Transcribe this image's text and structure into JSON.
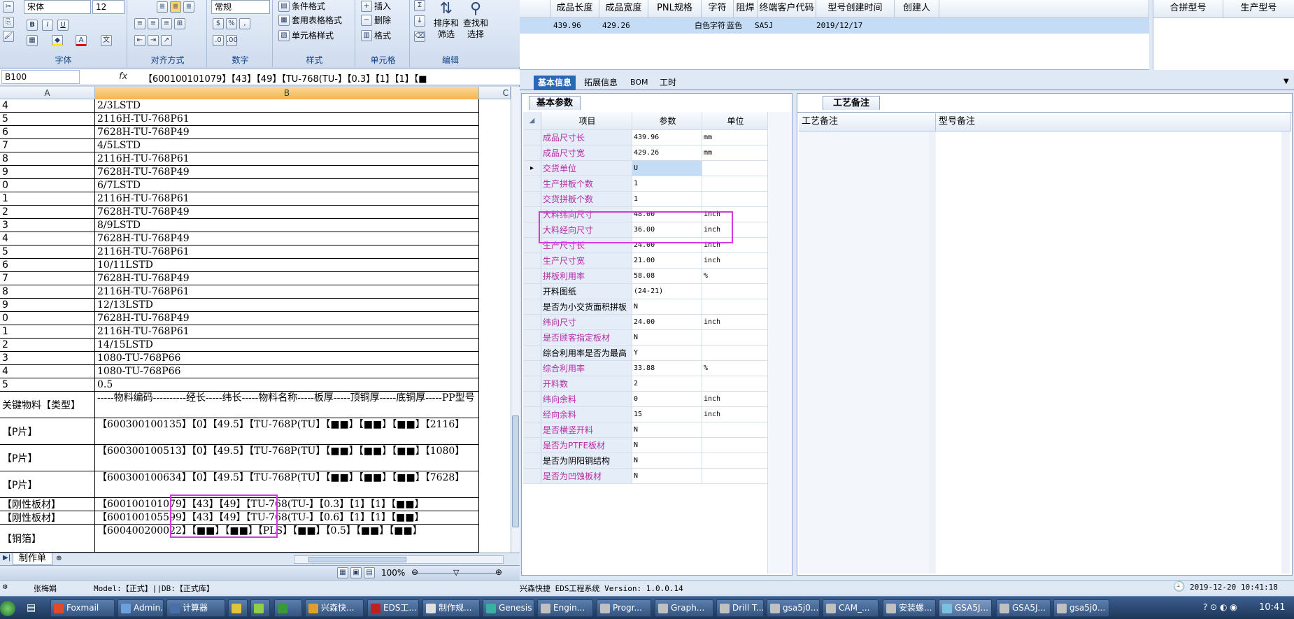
{
  "excel": {
    "font_name": "宋体",
    "font_size": "12",
    "number_format": "常规",
    "groups": [
      "字体",
      "对齐方式",
      "数字",
      "样式",
      "单元格",
      "编辑"
    ],
    "style_buttons": [
      "条件格式",
      "套用表格格式",
      "单元格样式"
    ],
    "cell_buttons": [
      "插入",
      "删除",
      "格式"
    ],
    "edit_buttons": [
      "排序和筛选",
      "查找和选择"
    ],
    "edit_sort_lines": [
      "排序和",
      "筛选"
    ],
    "edit_find_lines": [
      "查找和",
      "选择"
    ],
    "name_box": "B100",
    "formula": "【600100101079】【43】【49】【TU-768(TU-】【0.3】【1】【1】【■",
    "columns": [
      "A",
      "B",
      "C"
    ],
    "rows": [
      {
        "a": "4",
        "b": "2/3LSTD"
      },
      {
        "a": "5",
        "b": "2116H-TU-768P61"
      },
      {
        "a": "6",
        "b": "7628H-TU-768P49"
      },
      {
        "a": "7",
        "b": "4/5LSTD"
      },
      {
        "a": "8",
        "b": "2116H-TU-768P61"
      },
      {
        "a": "9",
        "b": "7628H-TU-768P49"
      },
      {
        "a": "0",
        "b": "6/7LSTD"
      },
      {
        "a": "1",
        "b": "2116H-TU-768P61"
      },
      {
        "a": "2",
        "b": "7628H-TU-768P49"
      },
      {
        "a": "3",
        "b": "8/9LSTD"
      },
      {
        "a": "4",
        "b": "7628H-TU-768P49"
      },
      {
        "a": "5",
        "b": "2116H-TU-768P61"
      },
      {
        "a": "6",
        "b": "10/11LSTD"
      },
      {
        "a": "7",
        "b": "7628H-TU-768P49"
      },
      {
        "a": "8",
        "b": "2116H-TU-768P61"
      },
      {
        "a": "9",
        "b": "12/13LSTD"
      },
      {
        "a": "0",
        "b": "7628H-TU-768P49"
      },
      {
        "a": "1",
        "b": "2116H-TU-768P61"
      },
      {
        "a": "2",
        "b": "14/15LSTD"
      },
      {
        "a": "3",
        "b": "1080-TU-768P66"
      },
      {
        "a": "4",
        "b": "1080-TU-768P66"
      },
      {
        "a": "5",
        "b": "0.5"
      }
    ],
    "tall_rows": [
      {
        "a": "关键物料【类型】",
        "b": "-----物料编码----------经长-----纬长-----物料名称-----板厚-----顶铜厚-----底铜厚-----PP型号"
      },
      {
        "a": "【P片】",
        "b": "【600300100135】【0】【49.5】【TU-768P(TU】【■■】【■■】【■■】【2116】"
      },
      {
        "a": "【P片】",
        "b": "【600300100513】【0】【49.5】【TU-768P(TU】【■■】【■■】【■■】【1080】"
      },
      {
        "a": "【P片】",
        "b": "【600300100634】【0】【49.5】【TU-768P(TU】【■■】【■■】【■■】【7628】"
      },
      {
        "a": "【刚性板材】",
        "b": "【600100101079】【43】【49】【TU-768(TU-】【0.3】【1】【1】【■■】"
      },
      {
        "a": "【刚性板材】",
        "b": "【600100105599】【43】【49】【TU-768(TU-】【0.6】【1】【1】【■■】"
      },
      {
        "a": "【铜箔】",
        "b": "【600400200022】【■■】【■■】【PLS】【■■】【0.5】【■■】【■■】"
      }
    ],
    "sheet_tab": "制作单",
    "zoom": "100%",
    "status_user": "张梅娟",
    "status_model": "Model:【正式】||DB:【正式库】"
  },
  "app": {
    "top_headers": [
      "成品长度",
      "成品宽度",
      "PNL规格",
      "字符",
      "阻焊",
      "终端客户代码",
      "型号创建时间",
      "创建人"
    ],
    "top_row": [
      "439.96",
      "429.26",
      "",
      "白色字符",
      "蓝色",
      "SA5J",
      "2019/12/17",
      ""
    ],
    "right_headers": [
      "合拼型号",
      "生产型号"
    ],
    "tabs": [
      "基本信息",
      "拓展信息",
      "BOM",
      "工时"
    ],
    "panel_title": "基本参数",
    "param_headers": [
      "项目",
      "参数",
      "单位"
    ],
    "params": [
      {
        "name": "成品尺寸长",
        "value": "439.96",
        "unit": "mm",
        "pink": true
      },
      {
        "name": "成品尺寸宽",
        "value": "429.26",
        "unit": "mm",
        "pink": true
      },
      {
        "name": "交货单位",
        "value": "U",
        "unit": "",
        "pink": true
      },
      {
        "name": "生产拼板个数",
        "value": "1",
        "unit": "",
        "pink": true
      },
      {
        "name": "交货拼板个数",
        "value": "1",
        "unit": "",
        "pink": true
      },
      {
        "name": "大料纬向尺寸",
        "value": "48.00",
        "unit": "inch",
        "pink": true
      },
      {
        "name": "大料经向尺寸",
        "value": "36.00",
        "unit": "inch",
        "pink": true
      },
      {
        "name": "生产尺寸长",
        "value": "24.00",
        "unit": "inch",
        "pink": true
      },
      {
        "name": "生产尺寸宽",
        "value": "21.00",
        "unit": "inch",
        "pink": true
      },
      {
        "name": "拼板利用率",
        "value": "58.08",
        "unit": "%",
        "pink": true
      },
      {
        "name": "开料图纸",
        "value": "(24-21)",
        "unit": "",
        "pink": false
      },
      {
        "name": "是否为小交货面积拼板",
        "value": "N",
        "unit": "",
        "pink": false
      },
      {
        "name": "纬向尺寸",
        "value": "24.00",
        "unit": "inch",
        "pink": true
      },
      {
        "name": "是否顾客指定板材",
        "value": "N",
        "unit": "",
        "pink": true
      },
      {
        "name": "综合利用率是否为最高",
        "value": "Y",
        "unit": "",
        "pink": false
      },
      {
        "name": "综合利用率",
        "value": "33.88",
        "unit": "%",
        "pink": true
      },
      {
        "name": "开料数",
        "value": "2",
        "unit": "",
        "pink": true
      },
      {
        "name": "纬向余料",
        "value": "0",
        "unit": "inch",
        "pink": true
      },
      {
        "name": "经向余料",
        "value": "15",
        "unit": "inch",
        "pink": true
      },
      {
        "name": "是否横竖开料",
        "value": "N",
        "unit": "",
        "pink": true
      },
      {
        "name": "是否为PTFE板材",
        "value": "N",
        "unit": "",
        "pink": true
      },
      {
        "name": "是否为阴阳铜结构",
        "value": "N",
        "unit": "",
        "pink": false
      },
      {
        "name": "是否为凹蚀板材",
        "value": "N",
        "unit": "",
        "pink": true
      }
    ],
    "process_tab": "工艺备注",
    "notes_headers": [
      "工艺备注",
      "型号备注"
    ],
    "status_version": "兴森快捷 EDS工程系统 Version: 1.0.0.14",
    "status_time": "2019-12-20 10:41:18"
  },
  "taskbar": {
    "tasks": [
      "Foxmail",
      "Admin...",
      "计算器",
      "",
      "",
      "",
      "兴森快...",
      "EDS工...",
      "制作规...",
      "Genesis",
      "Engin...",
      "Progr...",
      "Graph...",
      "Drill T...",
      "gsa5j0...",
      "CAM_...",
      "安装螺...",
      "GSA5J...",
      "GSA5J...",
      "gsa5j0..."
    ],
    "clock": "10:41"
  },
  "colors": {
    "accent": "#2a67b8",
    "pink_label": "#b52ca4",
    "highlight": "#d23be0",
    "selected_row": "#c4dcf5"
  }
}
